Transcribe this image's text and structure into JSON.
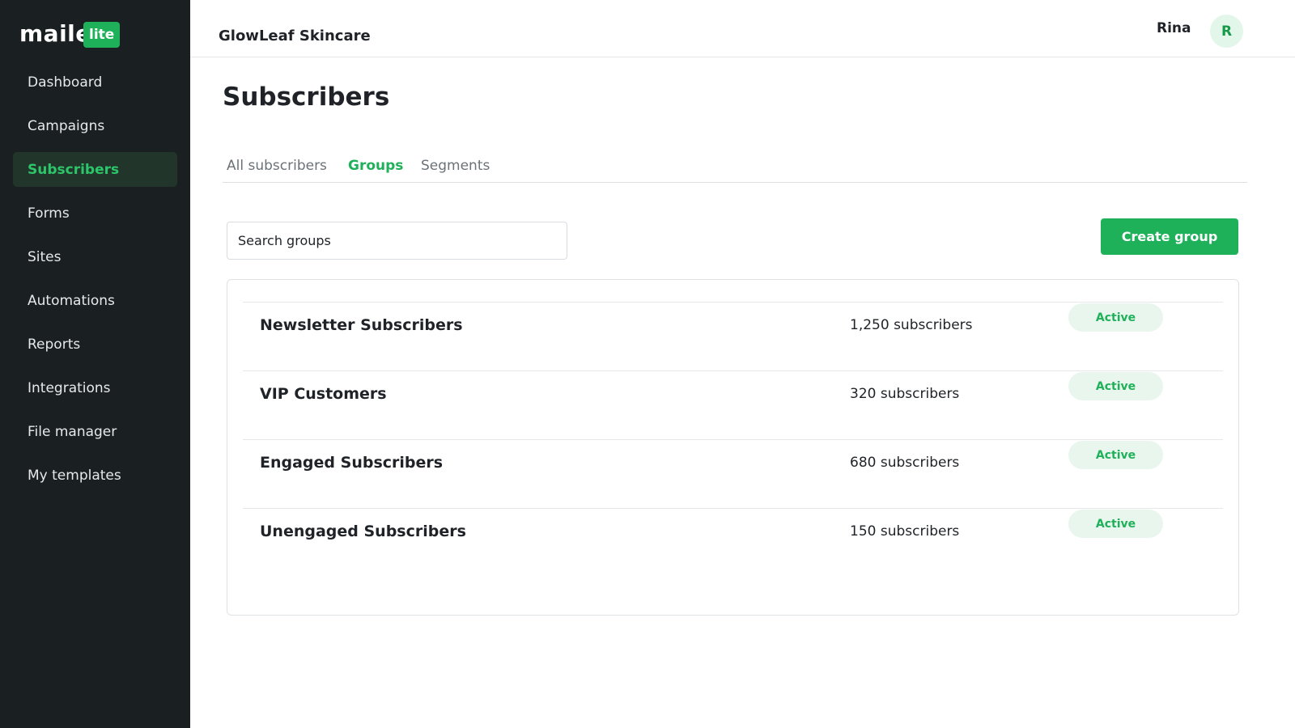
{
  "brand": {
    "logo_text": "maile",
    "logo_badge": "lite",
    "accent_color": "#1fb15a",
    "sidebar_color": "#1a1f22"
  },
  "sidebar": {
    "items": [
      {
        "label": "Dashboard",
        "active": false
      },
      {
        "label": "Campaigns",
        "active": false
      },
      {
        "label": "Subscribers",
        "active": true
      },
      {
        "label": "Forms",
        "active": false
      },
      {
        "label": "Sites",
        "active": false
      },
      {
        "label": "Automations",
        "active": false
      },
      {
        "label": "Reports",
        "active": false
      },
      {
        "label": "Integrations",
        "active": false
      },
      {
        "label": "File manager",
        "active": false
      },
      {
        "label": "My templates",
        "active": false
      }
    ]
  },
  "header": {
    "account_name": "GlowLeaf Skincare",
    "user_name": "Rina",
    "avatar_initial": "R"
  },
  "main": {
    "title": "Subscribers",
    "tabs": [
      {
        "label": "All subscribers",
        "active": false
      },
      {
        "label": "Groups",
        "active": true
      },
      {
        "label": "Segments",
        "active": false
      }
    ],
    "search": {
      "placeholder": "Search groups",
      "value": ""
    },
    "create_button_label": "Create group",
    "groups": [
      {
        "name": "Newsletter Subscribers",
        "count": "1,250 subscribers",
        "status": "Active"
      },
      {
        "name": "VIP Customers",
        "count": "320 subscribers",
        "status": "Active"
      },
      {
        "name": "Engaged Subscribers",
        "count": "680 subscribers",
        "status": "Active"
      },
      {
        "name": "Unengaged Subscribers",
        "count": "150 subscribers",
        "status": "Active"
      }
    ]
  }
}
